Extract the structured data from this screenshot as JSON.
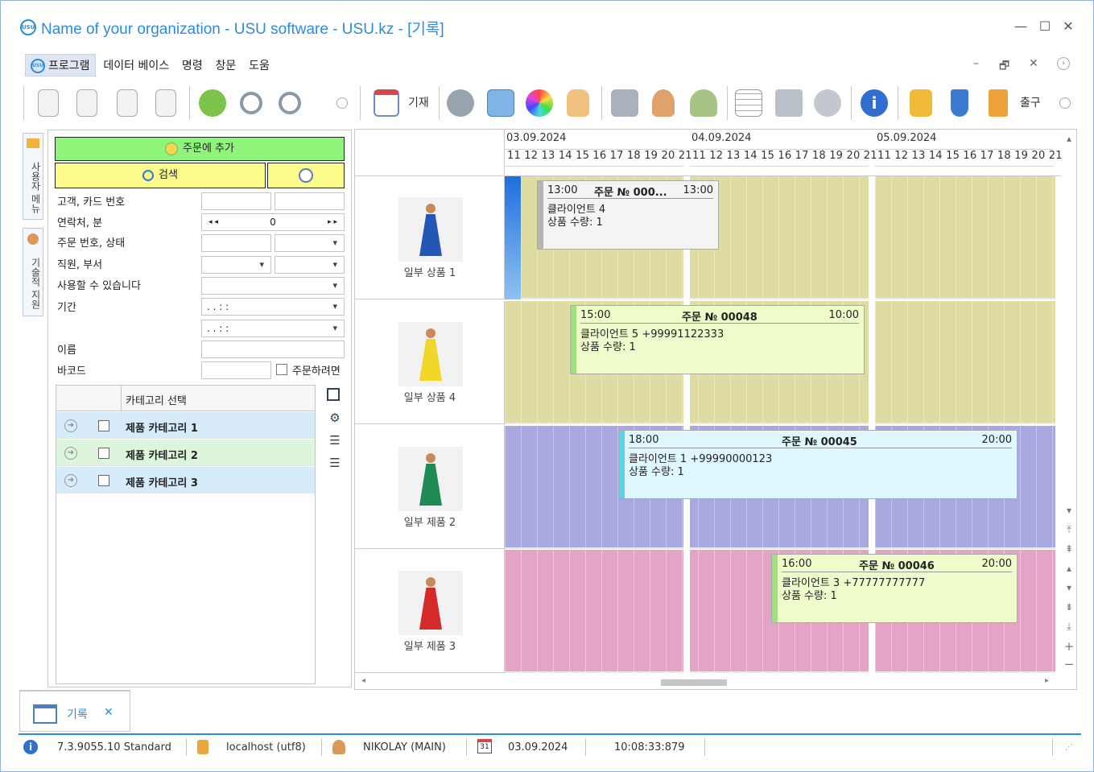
{
  "window": {
    "title": "Name of your organization - USU software - USU.kz - [기록]",
    "logo_text": "USU",
    "minimize": "—",
    "maximize": "☐",
    "close": "✕"
  },
  "menu": {
    "items": [
      "프로그램",
      "데이터 베이스",
      "명령",
      "창문",
      "도움"
    ],
    "mdi_minimize": "–",
    "mdi_restore": "🗗",
    "mdi_close": "✕"
  },
  "toolbar": {
    "record_label": "기재",
    "exit_label": "출구",
    "icons": [
      "add-doc-icon",
      "copy-doc-icon",
      "edit-doc-icon",
      "delete-doc-icon",
      "refresh-icon",
      "search-icon",
      "search-advanced-icon",
      "calendar-icon",
      "settings-gear-icon",
      "map-icon",
      "color-wheel-icon",
      "hand-icon",
      "rss-icon",
      "user-icon",
      "users-icon",
      "table-icon",
      "printer-icon",
      "forward-arrow-icon",
      "info-icon",
      "lock-icon",
      "plug-icon",
      "exit-door-icon"
    ]
  },
  "side_tabs": {
    "user_menu": "사용자 메뉴",
    "technical_support": "기술적 지원"
  },
  "filter_panel": {
    "add_to_order": "주문에 추가",
    "search": "검색",
    "fields": {
      "customer_card": "고객, 카드 번호",
      "contacts_min": "연락처, 분",
      "order_status": "주문 번호, 상태",
      "employee_dept": "직원, 부서",
      "available": "사용할 수 있습니다",
      "period": "기간",
      "name": "이름",
      "barcode": "바코드"
    },
    "contacts_value": "0",
    "period_from": ". .     : :",
    "period_to": ". .     : :",
    "to_order_checkbox": "주문하려면",
    "category_header": "카테고리 선택",
    "categories": [
      {
        "label": "제품 카테고리",
        "num": "1",
        "color": "#d6ecfb"
      },
      {
        "label": "제품 카테고리",
        "num": "2",
        "color": "#dcf5dc"
      },
      {
        "label": "제품 카테고리",
        "num": "3",
        "color": "#d6ecfb"
      }
    ]
  },
  "schedule": {
    "days": [
      {
        "date": "03.09.2024",
        "hours": "11 12 13 14 15 16 17 18 19 20 21"
      },
      {
        "date": "04.09.2024",
        "hours": "11 12 13 14 15 16 17 18 19 20 21"
      },
      {
        "date": "05.09.2024",
        "hours": "11 12 13 14 15 16 17 18 19 20 21"
      }
    ],
    "resources": [
      {
        "label": "일부 상품 1",
        "lane_color": "#dedca2",
        "dress": "#2456b8"
      },
      {
        "label": "일부 상품 4",
        "lane_color": "#dedca2",
        "dress": "#f2d628"
      },
      {
        "label": "일부 제품 2",
        "lane_color": "#aaa8e0",
        "dress": "#1f8a55"
      },
      {
        "label": "일부 제품 3",
        "lane_color": "#e3a4c6",
        "dress": "#d42a2a"
      }
    ],
    "appointments": [
      {
        "start": "13:00",
        "order": "주문 № 000...",
        "end": "13:00",
        "client": "클라이언트 4",
        "qty": "상품 수량: 1",
        "bg": "#f4f4f4",
        "bar": "#b5b5b5"
      },
      {
        "start": "15:00",
        "order": "주문 № 00048",
        "end": "10:00",
        "client": "클라이언트 5 +99991122333",
        "qty": "상품 수량: 1",
        "bg": "#eefccc",
        "bar": "#9ee37a"
      },
      {
        "start": "18:00",
        "order": "주문 № 00045",
        "end": "20:00",
        "client": "클라이언트 1 +99990000123",
        "qty": "상품 수량: 1",
        "bg": "#dff8ff",
        "bar": "#5cd3ee"
      },
      {
        "start": "16:00",
        "order": "주문 № 00046",
        "end": "20:00",
        "client": "클라이언트 3 +77777777777",
        "qty": "상품 수량: 1",
        "bg": "#eefccc",
        "bar": "#9ee37a"
      }
    ]
  },
  "bottom_tab": {
    "label": "기록",
    "close": "✕"
  },
  "status_bar": {
    "version": "7.3.9055.10 Standard",
    "db": "localhost (utf8)",
    "user": "NIKOLAY (MAIN)",
    "calendar_day": "31",
    "date": "03.09.2024",
    "time": "10:08:33:879"
  }
}
